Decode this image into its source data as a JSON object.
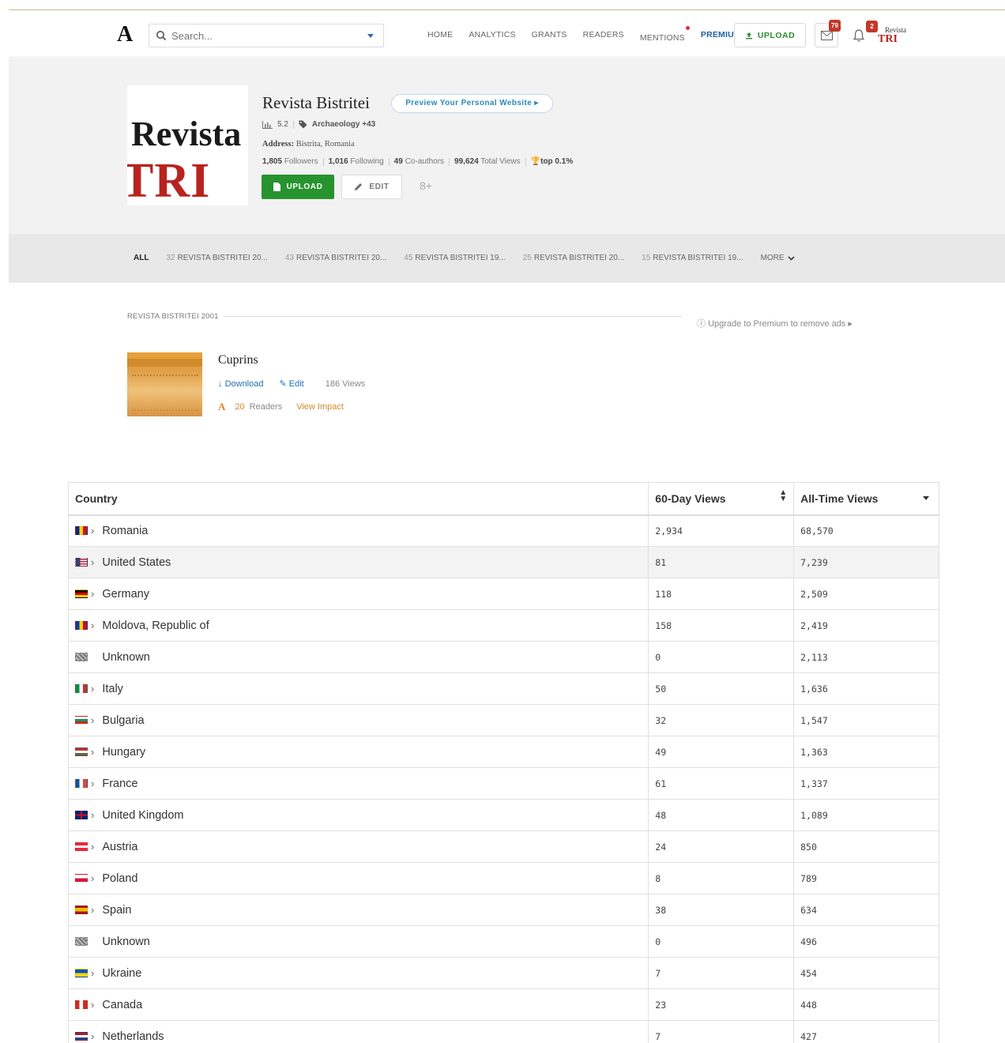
{
  "header": {
    "logo": "A",
    "search_placeholder": "Search...",
    "nav": [
      {
        "label": "HOME"
      },
      {
        "label": "ANALYTICS"
      },
      {
        "label": "GRANTS"
      },
      {
        "label": "READERS"
      },
      {
        "label": "MENTIONS"
      },
      {
        "label": "PREMIUM"
      }
    ],
    "upload_label": "UPLOAD",
    "messages_badge": "79",
    "notifications_badge": "2",
    "avatar_line1": "Revista",
    "avatar_line2": "TRI"
  },
  "profile": {
    "image_line1": "Revista",
    "image_line2": "TRI",
    "name": "Revista Bistritei",
    "preview_label": "Preview Your Personal Website",
    "score": "5.2",
    "tag": "Archaeology +43",
    "address_label": "Address:",
    "address_value": "Bistrita, Romania",
    "followers_count": "1,805",
    "followers_label": "Followers",
    "following_count": "1,016",
    "following_label": "Following",
    "coauthors_count": "49",
    "coauthors_label": "Co-authors",
    "views_count": "99,624",
    "views_label": "Total Views",
    "rank": "top 0.1%",
    "upload_label": "UPLOAD",
    "edit_label": "EDIT",
    "gplus": "8+"
  },
  "tabs": [
    {
      "num": "",
      "label": "ALL"
    },
    {
      "num": "32",
      "label": "REVISTA BISTRITEI 20..."
    },
    {
      "num": "43",
      "label": "REVISTA BISTRITEI 20..."
    },
    {
      "num": "45",
      "label": "REVISTA BISTRITEI 19..."
    },
    {
      "num": "25",
      "label": "REVISTA BISTRITEI 20..."
    },
    {
      "num": "15",
      "label": "REVISTA BISTRITEI 19..."
    },
    {
      "num": "",
      "label": "MORE"
    }
  ],
  "section": {
    "title": "REVISTA BISTRITEI 2001",
    "upgrade": "Upgrade to Premium to remove ads"
  },
  "paper": {
    "title": "Cuprins",
    "download": "Download",
    "edit": "Edit",
    "views": "186 Views",
    "readers_count": "20",
    "readers_label": "Readers",
    "impact": "View Impact"
  },
  "table": {
    "headers": [
      "Country",
      "60-Day Views",
      "All-Time Views"
    ],
    "rows": [
      {
        "country": "Romania",
        "d60": "2,934",
        "all": "68,570",
        "flag": [
          "#002b7f",
          "#fcd116",
          "#ce1126"
        ],
        "orient": "v"
      },
      {
        "country": "United States",
        "d60": "81",
        "all": "7,239",
        "flag": [
          "#3c3b6e",
          "#ffffff",
          "#b22234"
        ],
        "orient": "us"
      },
      {
        "country": "Germany",
        "d60": "118",
        "all": "2,509",
        "flag": [
          "#000000",
          "#dd0000",
          "#ffce00"
        ],
        "orient": "h"
      },
      {
        "country": "Moldova, Republic of",
        "d60": "158",
        "all": "2,419",
        "flag": [
          "#003da5",
          "#ffd200",
          "#cc092f"
        ],
        "orient": "v"
      },
      {
        "country": "Unknown",
        "d60": "0",
        "all": "2,113",
        "flag": [
          "#777777",
          "#bbbbbb",
          "#555555"
        ],
        "orient": "unk"
      },
      {
        "country": "Italy",
        "d60": "50",
        "all": "1,636",
        "flag": [
          "#009246",
          "#ffffff",
          "#ce2b37"
        ],
        "orient": "v"
      },
      {
        "country": "Bulgaria",
        "d60": "32",
        "all": "1,547",
        "flag": [
          "#ffffff",
          "#00966e",
          "#d62612"
        ],
        "orient": "h"
      },
      {
        "country": "Hungary",
        "d60": "49",
        "all": "1,363",
        "flag": [
          "#ce2939",
          "#ffffff",
          "#477050"
        ],
        "orient": "h"
      },
      {
        "country": "France",
        "d60": "61",
        "all": "1,337",
        "flag": [
          "#0055a4",
          "#ffffff",
          "#ef4135"
        ],
        "orient": "v"
      },
      {
        "country": "United Kingdom",
        "d60": "48",
        "all": "1,089",
        "flag": [
          "#012169",
          "#ffffff",
          "#c8102e"
        ],
        "orient": "uk"
      },
      {
        "country": "Austria",
        "d60": "24",
        "all": "850",
        "flag": [
          "#ed2939",
          "#ffffff",
          "#ed2939"
        ],
        "orient": "h"
      },
      {
        "country": "Poland",
        "d60": "8",
        "all": "789",
        "flag": [
          "#ffffff",
          "#dc143c",
          "#dc143c"
        ],
        "orient": "h2"
      },
      {
        "country": "Spain",
        "d60": "38",
        "all": "634",
        "flag": [
          "#aa151b",
          "#f1bf00",
          "#aa151b"
        ],
        "orient": "es"
      },
      {
        "country": "Unknown",
        "d60": "0",
        "all": "496",
        "flag": [
          "#777777",
          "#bbbbbb",
          "#555555"
        ],
        "orient": "unk"
      },
      {
        "country": "Ukraine",
        "d60": "7",
        "all": "454",
        "flag": [
          "#0057b7",
          "#ffd700",
          "#ffd700"
        ],
        "orient": "h2"
      },
      {
        "country": "Canada",
        "d60": "23",
        "all": "448",
        "flag": [
          "#d52b1e",
          "#ffffff",
          "#d52b1e"
        ],
        "orient": "v"
      },
      {
        "country": "Netherlands",
        "d60": "7",
        "all": "427",
        "flag": [
          "#ae1c28",
          "#ffffff",
          "#21468b"
        ],
        "orient": "h"
      }
    ]
  }
}
